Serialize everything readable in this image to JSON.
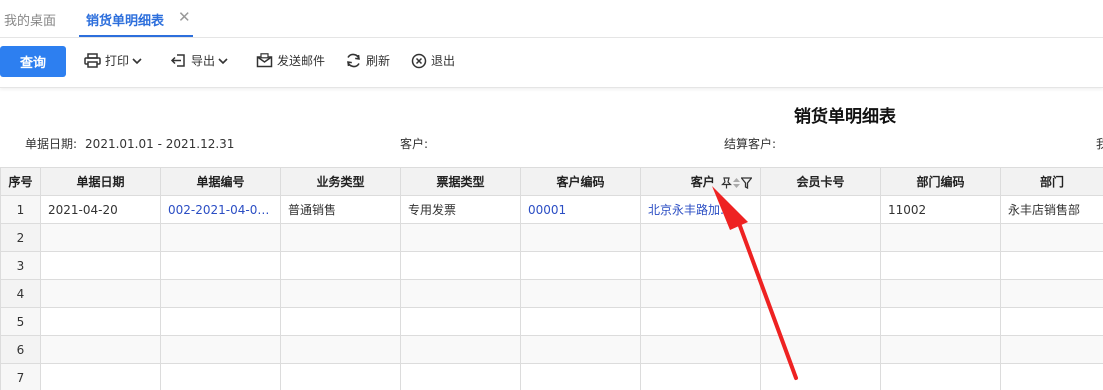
{
  "tabs": {
    "home": "我的桌面",
    "active": "销货单明细表",
    "close": "✕"
  },
  "toolbar": {
    "query": "查询",
    "print": "打印",
    "export": "导出",
    "email": "发送邮件",
    "refresh": "刷新",
    "exit": "退出"
  },
  "report": {
    "title": "销货单明细表",
    "filters": {
      "date_label": "单据日期:",
      "date_value": "2021.01.01 - 2021.12.31",
      "customer_label": "客户:",
      "settle_label": "结算客户:",
      "cut_label": "我"
    }
  },
  "grid": {
    "headers": [
      "序号",
      "单据日期",
      "单据编号",
      "业务类型",
      "票据类型",
      "客户编码",
      "客户",
      "会员卡号",
      "部门编码",
      "部门"
    ],
    "rows": [
      {
        "seq": "1",
        "date": "2021-04-20",
        "code": "002-2021-04-00…",
        "biz": "普通销售",
        "bill": "专用发票",
        "cust_code": "00001",
        "cust": "北京永丰路加…",
        "member": "",
        "dept_code": "11002",
        "dept": "永丰店销售部"
      },
      {
        "seq": "2"
      },
      {
        "seq": "3"
      },
      {
        "seq": "4"
      },
      {
        "seq": "5"
      },
      {
        "seq": "6"
      },
      {
        "seq": "7"
      }
    ]
  },
  "colors": {
    "accent": "#2d7ff0",
    "link": "#2b4ec4",
    "annotation": "#ee2222"
  }
}
